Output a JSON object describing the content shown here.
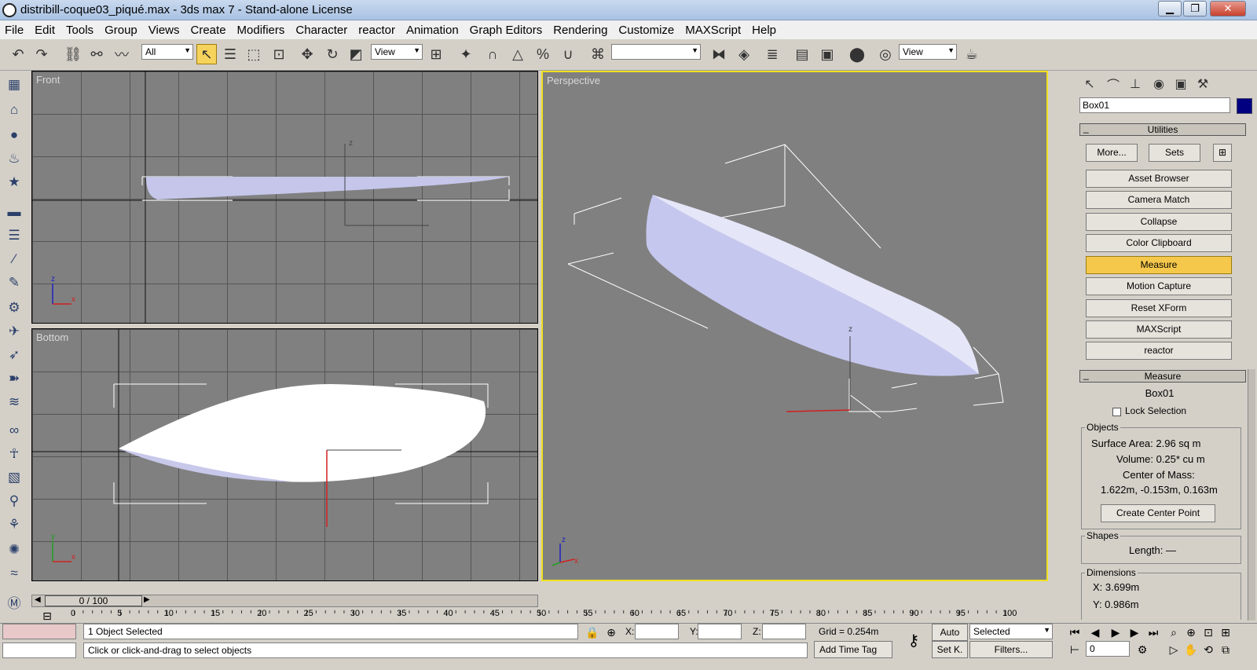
{
  "window": {
    "title": "distribill-coque03_piqué.max - 3ds max 7  - Stand-alone License",
    "minimize": "▁",
    "maximize": "❐",
    "close": "✕"
  },
  "menu": [
    "File",
    "Edit",
    "Tools",
    "Group",
    "Views",
    "Create",
    "Modifiers",
    "Character",
    "reactor",
    "Animation",
    "Graph Editors",
    "Rendering",
    "Customize",
    "MAXScript",
    "Help"
  ],
  "toolbar": {
    "selection_filter": "All",
    "ref_coord_1": "View",
    "named_selection": "",
    "ref_coord_2": "View"
  },
  "viewports": {
    "front": "Front",
    "bottom": "Bottom",
    "perspective": "Perspective"
  },
  "axis": {
    "x": "x",
    "y": "y",
    "z": "z"
  },
  "command_panel": {
    "object_name": "Box01",
    "swatch_color": "#000080",
    "utilities_title": "Utilities",
    "more": "More...",
    "sets": "Sets",
    "utility_buttons": [
      "Asset Browser",
      "Camera Match",
      "Collapse",
      "Color Clipboard",
      "Measure",
      "Motion Capture",
      "Reset XForm",
      "MAXScript",
      "reactor"
    ],
    "active_utility": "Measure",
    "measure": {
      "title": "Measure",
      "object": "Box01",
      "lock_selection": "Lock Selection",
      "objects_label": "Objects",
      "surface_area": "Surface Area:  2.96 sq m",
      "volume": "Volume:  0.25* cu m",
      "center_of_mass_label": "Center of Mass:",
      "center_of_mass": "1.622m, -0.153m, 0.163m",
      "create_center_point": "Create Center Point",
      "shapes_label": "Shapes",
      "length": "Length:  —",
      "dimensions_label": "Dimensions",
      "dim_x": "X:   3.699m",
      "dim_y": "Y:   0.986m"
    }
  },
  "timeline": {
    "frame": "0 / 100",
    "ticks": [
      "0",
      "5",
      "10",
      "15",
      "20",
      "25",
      "30",
      "35",
      "40",
      "45",
      "50",
      "55",
      "60",
      "65",
      "70",
      "75",
      "80",
      "85",
      "90",
      "95",
      "100"
    ]
  },
  "status": {
    "selection": "1 Object Selected",
    "prompt": "Click or click-and-drag to select objects",
    "x_label": "X:",
    "y_label": "Y:",
    "z_label": "Z:",
    "grid": "Grid = 0.254m",
    "add_time_tag": "Add Time Tag",
    "auto": "Auto",
    "set_key": "Set K.",
    "key_filter": "Selected",
    "filters": "Filters...",
    "current_frame": "0"
  },
  "colors": {
    "active_button": "#f5c84c",
    "viewport_bg": "#808080",
    "active_viewport_border": "#f0e020",
    "hull": "#c8c8ee"
  }
}
